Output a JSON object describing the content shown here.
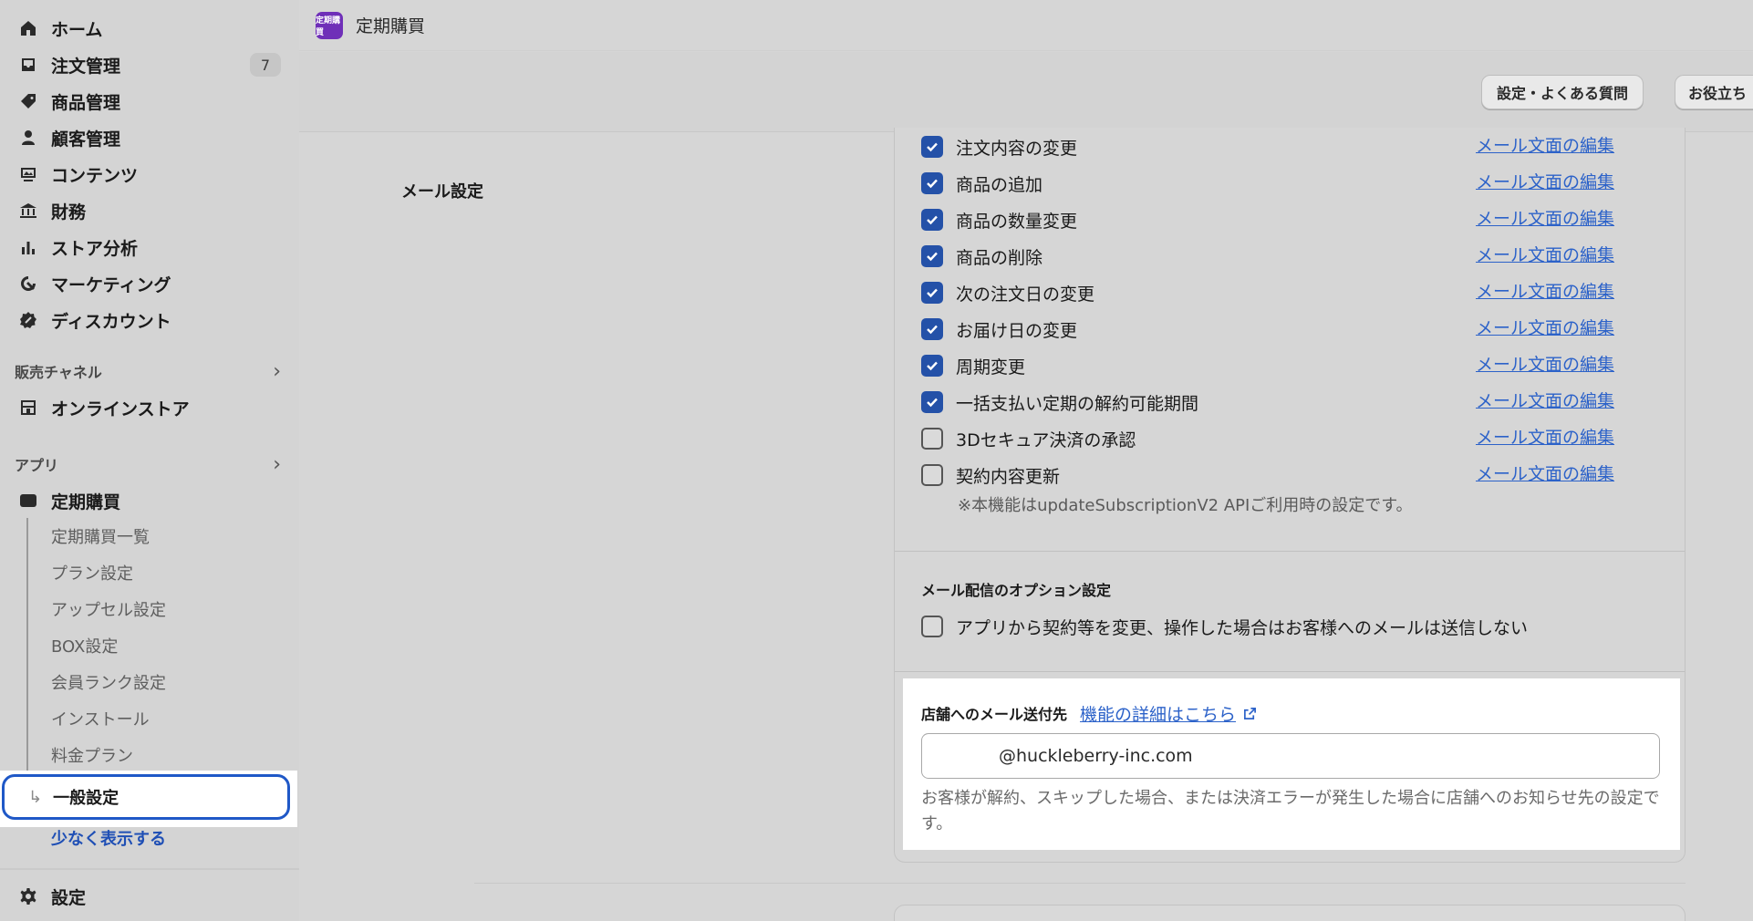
{
  "sidebar": {
    "items": [
      {
        "label": "ホーム",
        "icon": "home-icon"
      },
      {
        "label": "注文管理",
        "icon": "inbox-icon",
        "badge": "7"
      },
      {
        "label": "商品管理",
        "icon": "tag-icon"
      },
      {
        "label": "顧客管理",
        "icon": "person-icon"
      },
      {
        "label": "コンテンツ",
        "icon": "content-icon"
      },
      {
        "label": "財務",
        "icon": "bank-icon"
      },
      {
        "label": "ストア分析",
        "icon": "bar-chart-icon"
      },
      {
        "label": "マーケティング",
        "icon": "target-icon"
      },
      {
        "label": "ディスカウント",
        "icon": "discount-icon"
      }
    ],
    "sales_channels": {
      "title": "販売チャネル",
      "online_store": "オンラインストア"
    },
    "apps": {
      "title": "アプリ",
      "app_name": "定期購買",
      "sub_items": [
        "定期購買一覧",
        "プラン設定",
        "アップセル設定",
        "BOX設定",
        "会員ランク設定",
        "インストール",
        "料金プラン"
      ],
      "selected": "一般設定",
      "show_less": "少なく表示する"
    },
    "settings": "設定"
  },
  "topbar": {
    "app_logo_text": "定期購買",
    "title": "定期購買"
  },
  "header": {
    "faq_button": "設定・よくある質問",
    "help_button": "お役立ち"
  },
  "main": {
    "section_label": "メール設定",
    "edit_link": "メール文面の編集",
    "checks": [
      {
        "label": "注文内容の変更",
        "checked": true
      },
      {
        "label": "商品の追加",
        "checked": true
      },
      {
        "label": "商品の数量変更",
        "checked": true
      },
      {
        "label": "商品の削除",
        "checked": true
      },
      {
        "label": "次の注文日の変更",
        "checked": true
      },
      {
        "label": "お届け日の変更",
        "checked": true
      },
      {
        "label": "周期変更",
        "checked": true
      },
      {
        "label": "一括支払い定期の解約可能期間",
        "checked": true
      },
      {
        "label": "3Dセキュア決済の承認",
        "checked": false
      },
      {
        "label": "契約内容更新",
        "checked": false
      }
    ],
    "note": "※本機能はupdateSubscriptionV2 APIご利用時の設定です。",
    "option_title": "メール配信のオプション設定",
    "option_check": "アプリから契約等を変更、操作した場合はお客様へのメールは送信しない",
    "store_email": {
      "title": "店舗へのメール送付先",
      "link": "機能の詳細はこちら",
      "value": "@huckleberry-inc.com",
      "help": "お客様が解約、スキップした場合、または決済エラーが発生した場合に店舗へのお知らせ先の設定です。"
    }
  },
  "colors": {
    "accent": "#2451a8",
    "link": "#2c62c9",
    "selection_border": "#1f58c7",
    "app_logo": "#6f2fb8"
  }
}
